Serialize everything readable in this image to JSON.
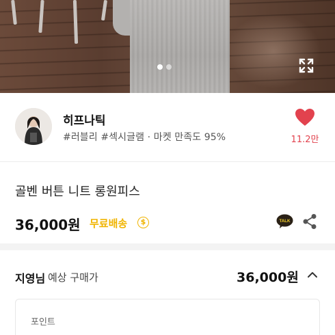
{
  "gallery": {
    "current_index": 1,
    "total_images": 2,
    "expand_icon": "expand-icon"
  },
  "seller": {
    "name": "히프나틱",
    "tags_line": "#러블리 #섹시글램 · 마켓 만족도 95%",
    "likes": "11.2만",
    "like_icon": "heart-icon",
    "like_color": "#e2424e"
  },
  "product": {
    "title": "골벤 버튼 니트 롱원피스",
    "price": "36,000원",
    "shipping": "무료배송",
    "shipping_color": "#f0b400",
    "info_icon_glyph": "$",
    "talk_icon_text": "TALK"
  },
  "estimate": {
    "user": "지영님",
    "label": "예상 구매가",
    "price": "36,000원"
  },
  "points": {
    "label": "포인트"
  }
}
